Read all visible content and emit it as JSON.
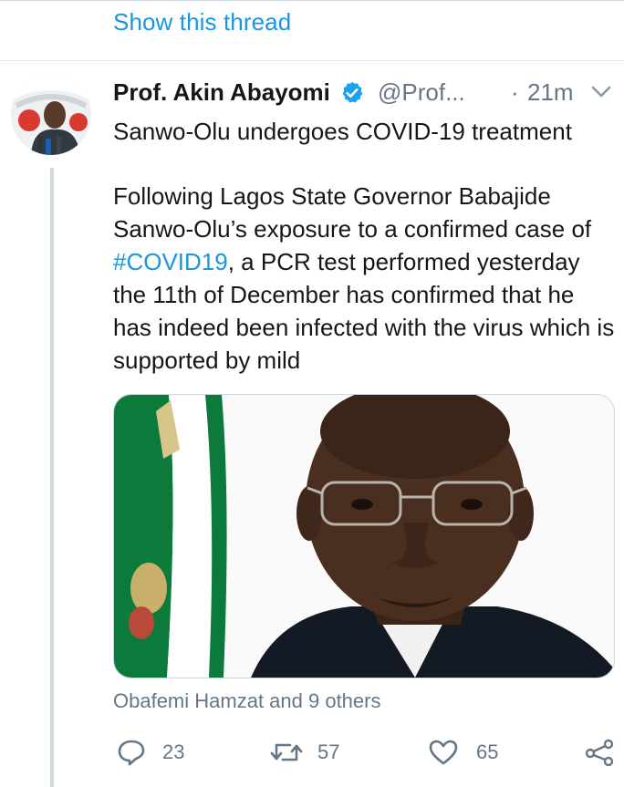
{
  "thread": {
    "show_label": "Show this thread"
  },
  "tweet": {
    "display_name": "Prof. Akin Abayomi",
    "handle": "@Prof...",
    "separator": "·",
    "time": "21m",
    "headline": "Sanwo-Olu undergoes COVID-19 treatment",
    "para_before": "Following Lagos State Governor Babajide Sanwo-Olu’s exposure to a confirmed case of ",
    "hashtag": "#COVID19",
    "para_after": ", a PCR test performed yesterday the 11th of December has confirmed that he has indeed been infected with the virus which is supported by mild",
    "tagged": "Obafemi Hamzat and 9 others",
    "replies": "23",
    "retweets": "57",
    "likes": "65"
  },
  "icons": {
    "verified": "verified-badge-icon",
    "caret": "chevron-down-icon",
    "reply": "reply-icon",
    "retweet": "retweet-icon",
    "like": "heart-icon",
    "share": "share-icon"
  },
  "colors": {
    "link": "#1b95e0",
    "muted": "#657786",
    "text": "#14171a"
  }
}
